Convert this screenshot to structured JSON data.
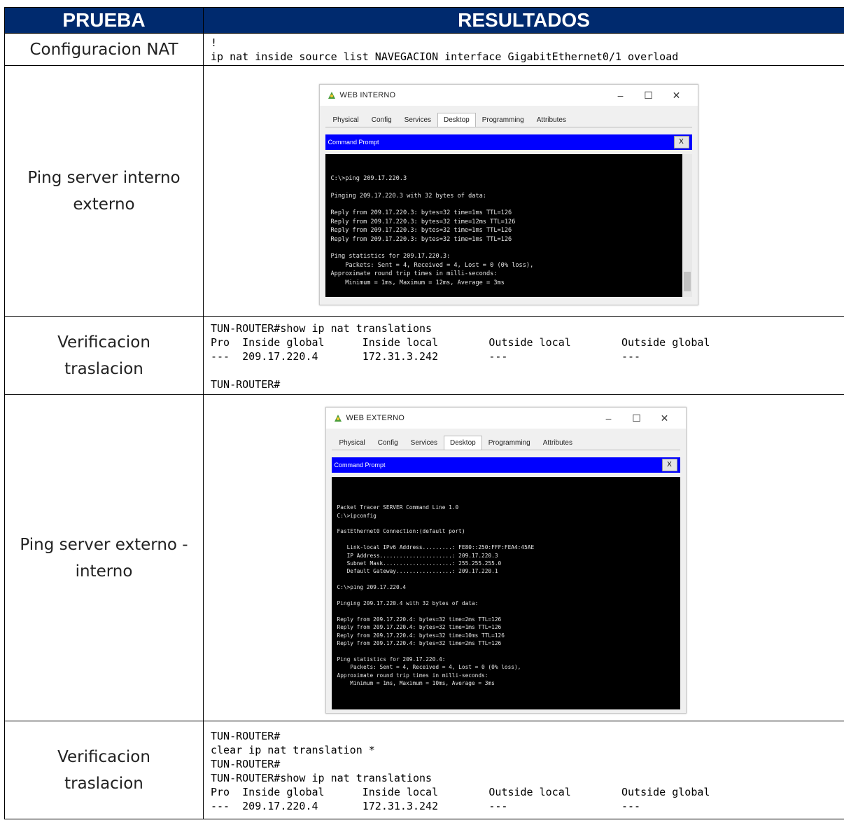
{
  "headers": {
    "col1": "PRUEBA",
    "col2": "RESULTADOS"
  },
  "rows": [
    {
      "label": [
        "Configuracion NAT"
      ],
      "lines": [
        "!",
        "ip nat inside source list NAVEGACION interface GigabitEthernet0/1 overload"
      ]
    },
    {
      "label": [
        "Ping server interno",
        "externo"
      ],
      "window": {
        "title": "WEB INTERNO",
        "tabs": [
          "Physical",
          "Config",
          "Services",
          "Desktop",
          "Programming",
          "Attributes"
        ],
        "active_tab": "Desktop",
        "cmd_title": "Command Prompt",
        "close_label": "X",
        "terminal": "C:\\>ping 209.17.220.3\n\nPinging 209.17.220.3 with 32 bytes of data:\n\nReply from 209.17.220.3: bytes=32 time=1ms TTL=126\nReply from 209.17.220.3: bytes=32 time=12ms TTL=126\nReply from 209.17.220.3: bytes=32 time=1ms TTL=126\nReply from 209.17.220.3: bytes=32 time=1ms TTL=126\n\nPing statistics for 209.17.220.3:\n    Packets: Sent = 4, Received = 4, Lost = 0 (0% loss),\nApproximate round trip times in milli-seconds:\n    Minimum = 1ms, Maximum = 12ms, Average = 3ms"
      }
    },
    {
      "label": [
        "Verificacion",
        "traslacion"
      ],
      "lines": [
        "TUN-ROUTER#show ip nat translations",
        "Pro  Inside global      Inside local        Outside local        Outside global",
        "---  209.17.220.4       172.31.3.242        ---                  ---",
        "",
        "TUN-ROUTER#"
      ]
    },
    {
      "label": [
        "Ping server externo -",
        "interno"
      ],
      "window": {
        "title": "WEB EXTERNO",
        "tabs": [
          "Physical",
          "Config",
          "Services",
          "Desktop",
          "Programming",
          "Attributes"
        ],
        "active_tab": "Desktop",
        "cmd_title": "Command Prompt",
        "close_label": "X",
        "terminal": "\nPacket Tracer SERVER Command Line 1.0\nC:\\>ipconfig\n\nFastEthernet0 Connection:(default port)\n\n   Link-local IPv6 Address.........: FE80::250:FFF:FEA4:45AE\n   IP Address......................: 209.17.220.3\n   Subnet Mask.....................: 255.255.255.0\n   Default Gateway.................: 209.17.220.1\n\nC:\\>ping 209.17.220.4\n\nPinging 209.17.220.4 with 32 bytes of data:\n\nReply from 209.17.220.4: bytes=32 time=2ms TTL=126\nReply from 209.17.220.4: bytes=32 time=1ms TTL=126\nReply from 209.17.220.4: bytes=32 time=10ms TTL=126\nReply from 209.17.220.4: bytes=32 time=2ms TTL=126\n\nPing statistics for 209.17.220.4:\n    Packets: Sent = 4, Received = 4, Lost = 0 (0% loss),\nApproximate round trip times in milli-seconds:\n    Minimum = 1ms, Maximum = 10ms, Average = 3ms"
      }
    },
    {
      "label": [
        "Verificacion",
        "traslacion"
      ],
      "lines": [
        "TUN-ROUTER#",
        "clear ip nat translation *",
        "TUN-ROUTER#",
        "TUN-ROUTER#show ip nat translations",
        "Pro  Inside global      Inside local        Outside local        Outside global",
        "---  209.17.220.4       172.31.3.242        ---                  ---"
      ]
    }
  ]
}
